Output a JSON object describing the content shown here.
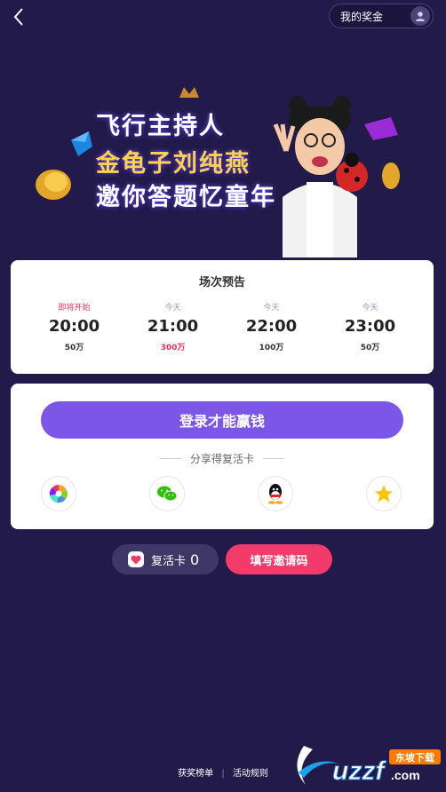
{
  "header": {
    "back_icon": "chevron-left-icon",
    "prize_label": "我的奖金",
    "avatar_icon": "user-icon"
  },
  "banner": {
    "line1": "飞行主持人",
    "line2": "金龟子刘纯燕",
    "line3": "邀你答题忆童年"
  },
  "schedule": {
    "title": "场次预告",
    "slots": [
      {
        "status": "即将开始",
        "time": "20:00",
        "prize": "50万"
      },
      {
        "status": "今天",
        "time": "21:00",
        "prize": "300万"
      },
      {
        "status": "今天",
        "time": "22:00",
        "prize": "100万"
      },
      {
        "status": "今天",
        "time": "23:00",
        "prize": "50万"
      }
    ]
  },
  "login": {
    "button_label": "登录才能赢钱",
    "share_label": "分享得复活卡",
    "share_icons": [
      "photos-icon",
      "wechat-icon",
      "qq-icon",
      "star-icon"
    ]
  },
  "revive": {
    "label": "复活卡",
    "count": "0"
  },
  "invite": {
    "label": "填写邀请码"
  },
  "footer": {
    "leaderboard": "获奖榜单",
    "separator": "|",
    "rules": "活动规则"
  },
  "watermark": {
    "brand": "uzzf",
    "suffix": ".com",
    "tag": "东坡下载"
  },
  "colors": {
    "background": "#221a49",
    "primary": "#7b56e7",
    "accent": "#f23b6a",
    "live": "#e8335e"
  }
}
